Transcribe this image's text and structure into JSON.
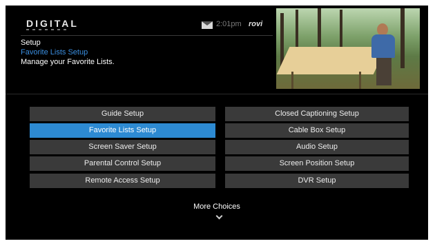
{
  "header": {
    "logo_text": "DIGITAL",
    "time": "2:01pm",
    "brand": "rovi",
    "mail_icon": "mail-icon"
  },
  "page": {
    "title": "Setup",
    "breadcrumb": "Favorite Lists Setup",
    "description": "Manage your Favorite Lists."
  },
  "colors": {
    "background": "#000000",
    "button": "#3a3a3a",
    "selected_button": "#2d8ad2",
    "breadcrumb_text": "#3a8ee0"
  },
  "menu": {
    "items": [
      {
        "label": "Guide Setup",
        "selected": false
      },
      {
        "label": "Closed Captioning Setup",
        "selected": false
      },
      {
        "label": "Favorite Lists Setup",
        "selected": true
      },
      {
        "label": "Cable Box Setup",
        "selected": false
      },
      {
        "label": "Screen Saver Setup",
        "selected": false
      },
      {
        "label": "Audio Setup",
        "selected": false
      },
      {
        "label": "Parental Control Setup",
        "selected": false
      },
      {
        "label": "Screen Position Setup",
        "selected": false
      },
      {
        "label": "Remote Access Setup",
        "selected": false
      },
      {
        "label": "DVR Setup",
        "selected": false
      }
    ],
    "more_label": "More Choices",
    "more_icon": "chevron-down-icon"
  }
}
